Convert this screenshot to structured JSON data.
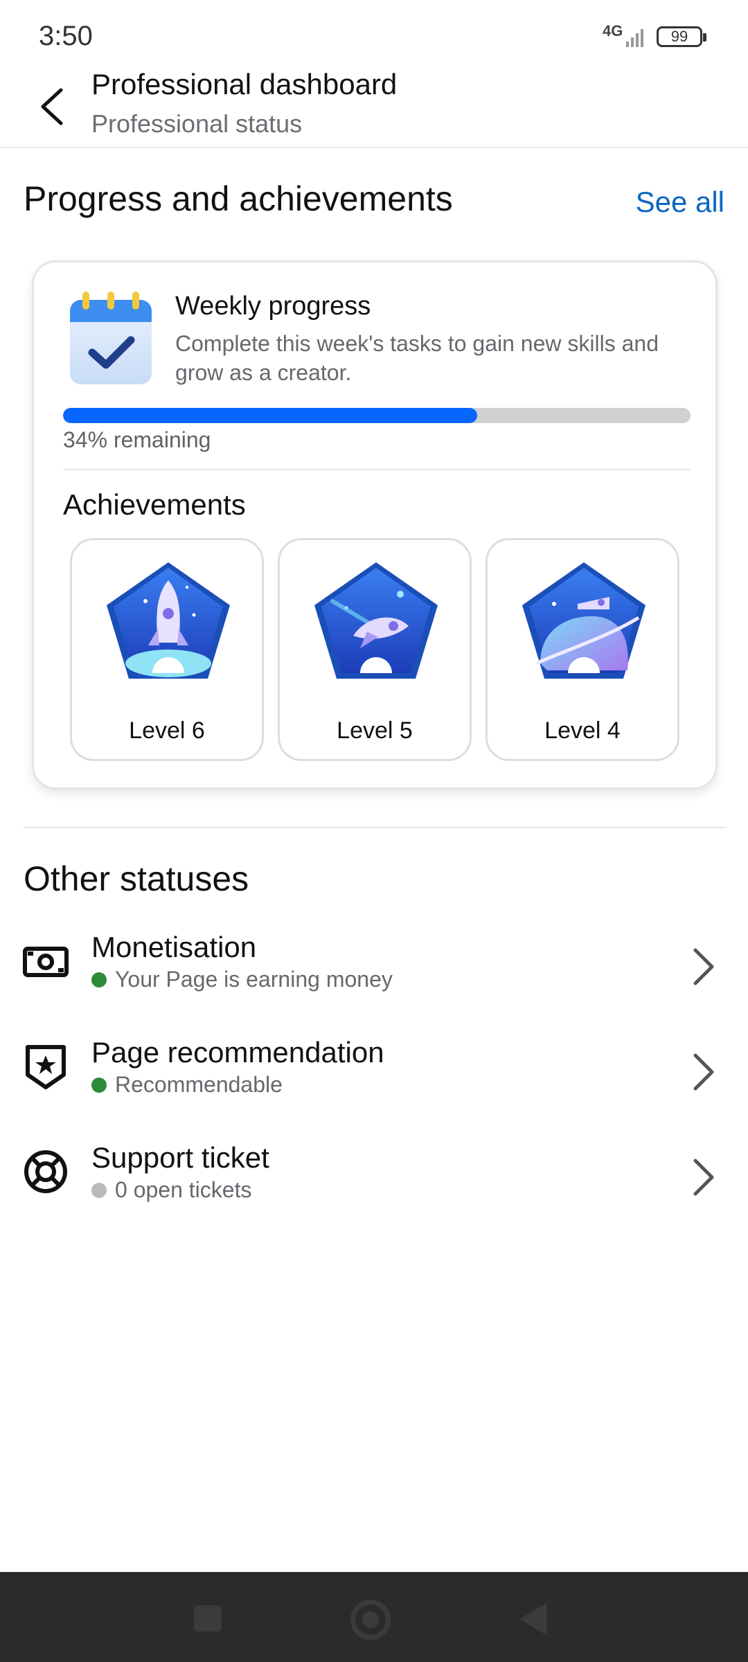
{
  "status_bar": {
    "time": "3:50",
    "network": "4G",
    "battery": "99"
  },
  "header": {
    "title": "Professional dashboard",
    "subtitle": "Professional status"
  },
  "progress_section": {
    "title": "Progress and achievements",
    "see_all": "See all"
  },
  "weekly_progress": {
    "title": "Weekly progress",
    "description": "Complete this week's tasks to gain new skills and grow as a creator.",
    "progress_fraction": 0.66,
    "remaining_text": "34% remaining",
    "accent_color": "#0866ff"
  },
  "achievements": {
    "title": "Achievements",
    "items": [
      {
        "label": "Level 6",
        "number": "6",
        "icon": "rocket-badge-icon"
      },
      {
        "label": "Level 5",
        "number": "5",
        "icon": "spaceship-badge-icon"
      },
      {
        "label": "Level 4",
        "number": "4",
        "icon": "planet-badge-icon"
      }
    ]
  },
  "other_statuses": {
    "title": "Other statuses",
    "items": [
      {
        "title": "Monetisation",
        "status": "Your Page is earning money",
        "status_color": "#2e8b3a",
        "icon": "money-icon"
      },
      {
        "title": "Page recommendation",
        "status": "Recommendable",
        "status_color": "#2e8b3a",
        "icon": "shield-star-icon"
      },
      {
        "title": "Support ticket",
        "status": "0 open tickets",
        "status_color": "#b8babe",
        "icon": "lifebuoy-icon"
      }
    ]
  }
}
